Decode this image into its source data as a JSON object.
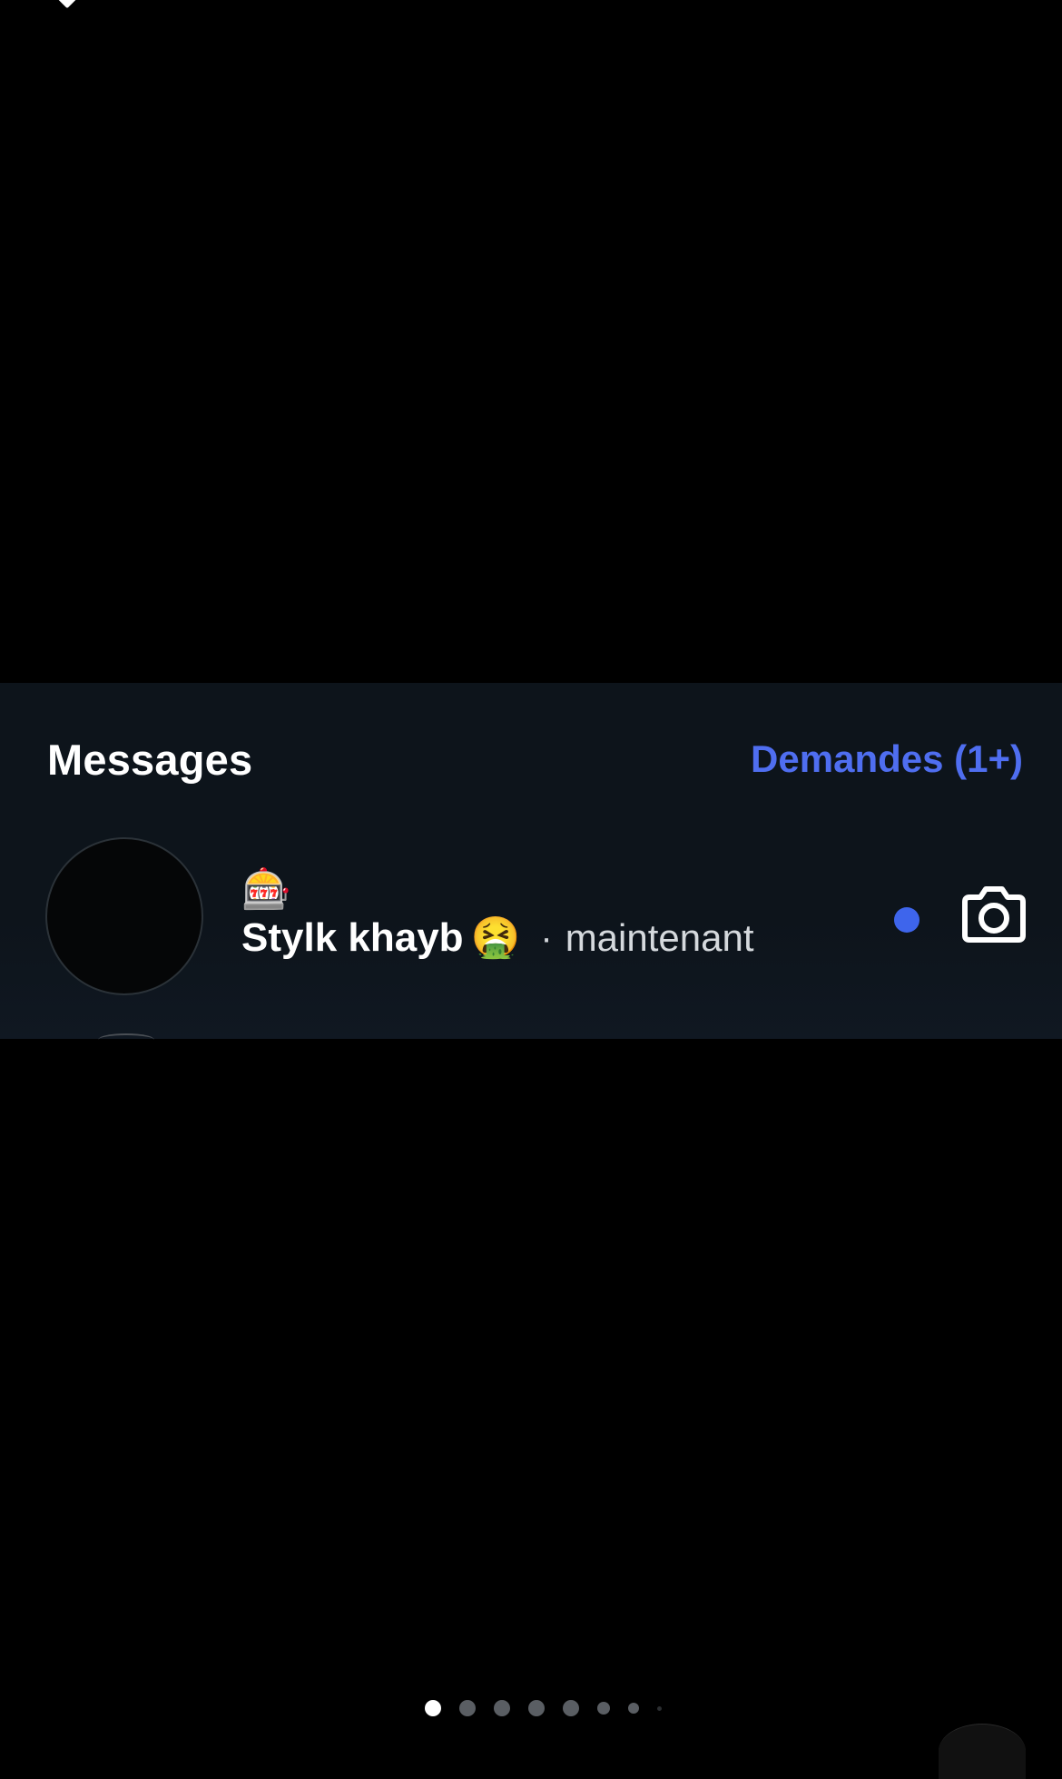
{
  "messages_panel": {
    "title": "Messages",
    "requests_label": "Demandes (1+)"
  },
  "thread": {
    "status_emoji": "🎰",
    "name": "Stylk khayb",
    "name_emoji": "🤮",
    "separator": "·",
    "timestamp": "maintenant",
    "unread": true,
    "camera_icon": "camera-icon"
  },
  "colors": {
    "panel_background": "#0d141b",
    "accent": "#4f6ef0",
    "unread_dot": "#3e65ec"
  },
  "pagination": {
    "current_page": 1,
    "visible_dot_count": 8
  }
}
